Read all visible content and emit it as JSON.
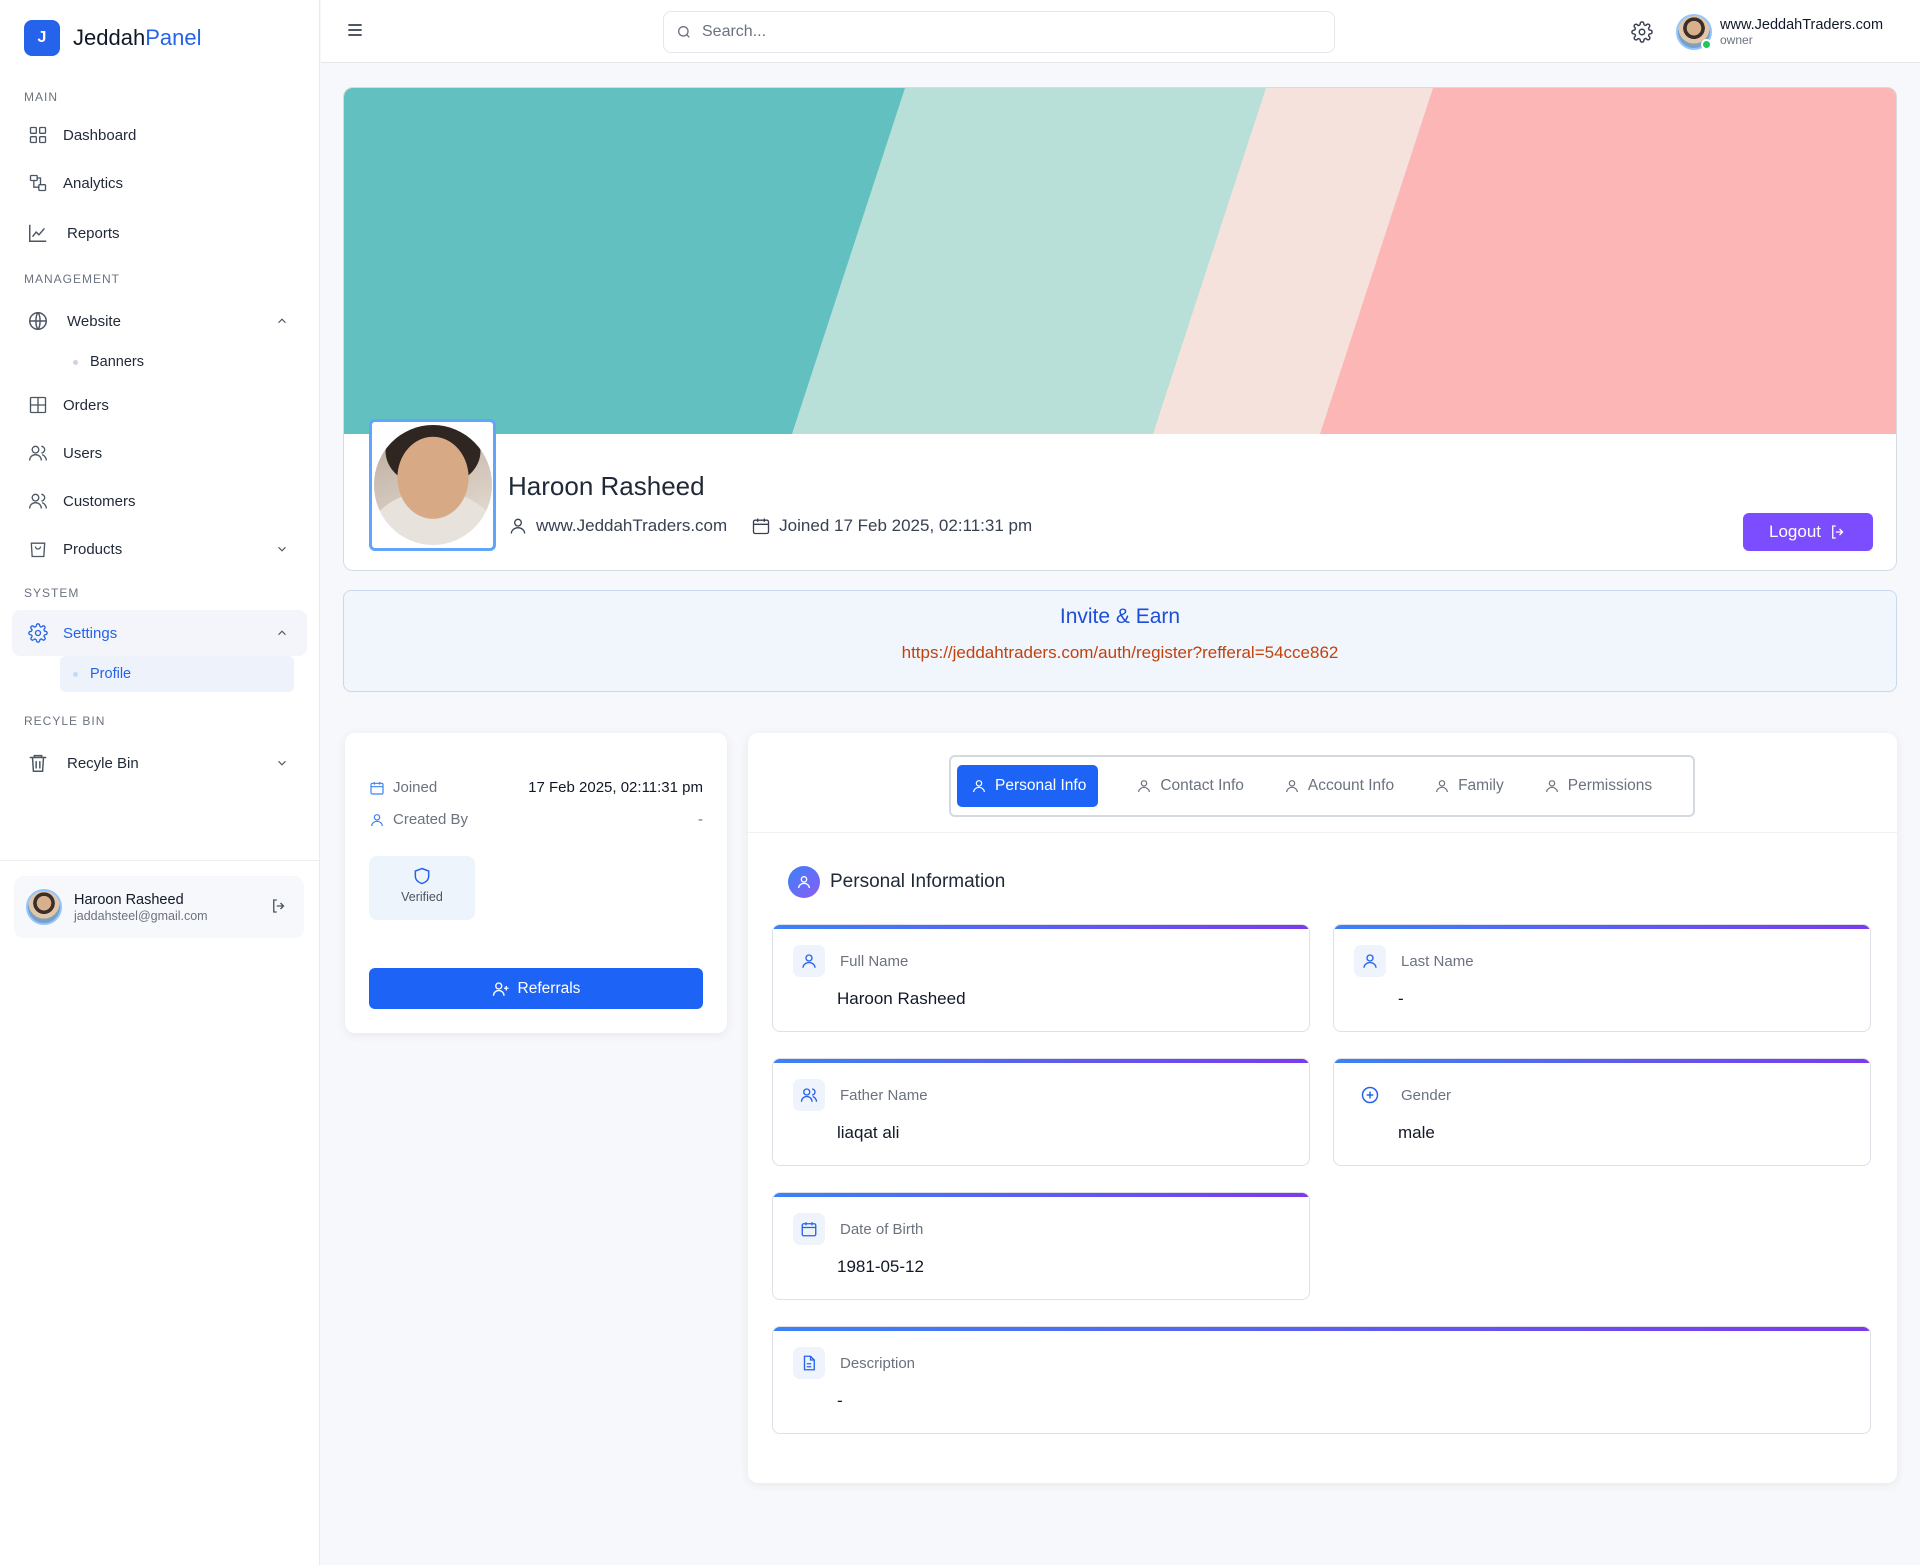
{
  "brand": {
    "logo_letter": "J",
    "name_part1": "Jeddah",
    "name_part2": "Panel",
    "accent_color": "#2563eb"
  },
  "sidebar": {
    "sections": {
      "main": "MAIN",
      "management": "MANAGEMENT",
      "system": "SYSTEM",
      "recycle": "RECYLE BIN"
    },
    "items": {
      "dashboard": "Dashboard",
      "analytics": "Analytics",
      "reports": "Reports",
      "website": "Website",
      "banners": "Banners",
      "orders": "Orders",
      "users": "Users",
      "customers": "Customers",
      "products": "Products",
      "settings": "Settings",
      "profile": "Profile",
      "recycle_bin": "Recyle Bin"
    },
    "user": {
      "name": "Haroon Rasheed",
      "email": "jaddahsteel@gmail.com"
    }
  },
  "header": {
    "search_placeholder": "Search...",
    "user_name": "www.JeddahTraders.com",
    "user_role": "owner"
  },
  "profile": {
    "name": "Haroon Rasheed",
    "website": "www.JeddahTraders.com",
    "joined": "Joined 17 Feb 2025, 02:11:31 pm",
    "logout_label": "Logout",
    "cover_colors": [
      "#63c0c0",
      "#b8e0d8",
      "#f6e2dc",
      "#fbb6b5"
    ]
  },
  "invite": {
    "title": "Invite & Earn",
    "link": "https://jeddahtraders.com/auth/register?refferal=54cce862"
  },
  "info_card": {
    "joined_label": "Joined",
    "joined_value": "17 Feb 2025, 02:11:31 pm",
    "created_by_label": "Created By",
    "created_by_value": "-",
    "verified_label": "Verified",
    "referrals_label": "Referrals"
  },
  "tabs": [
    "Personal Info",
    "Contact Info",
    "Account Info",
    "Family",
    "Permissions"
  ],
  "personal": {
    "title": "Personal Information",
    "fields": {
      "full_name": {
        "label": "Full Name",
        "value": "Haroon Rasheed"
      },
      "last_name": {
        "label": "Last Name",
        "value": "-"
      },
      "father_name": {
        "label": "Father Name",
        "value": "liaqat ali"
      },
      "gender": {
        "label": "Gender",
        "value": "male"
      },
      "dob": {
        "label": "Date of Birth",
        "value": "1981-05-12"
      },
      "description": {
        "label": "Description",
        "value": "-"
      }
    }
  },
  "colors": {
    "primary": "#1d63f5",
    "logout": "#7c4dff",
    "invite_link": "#c2410c"
  }
}
